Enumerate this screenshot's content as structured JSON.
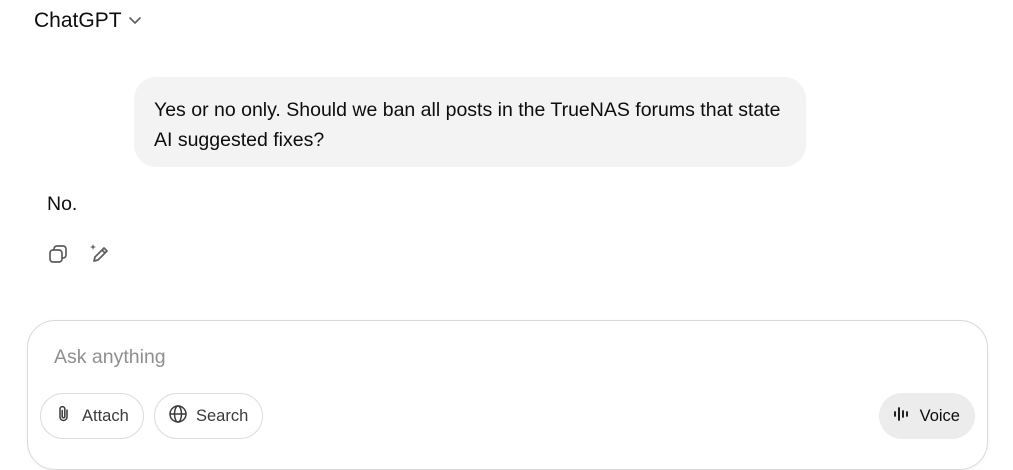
{
  "header": {
    "title": "ChatGPT",
    "menu_icon": "chevron-down-icon"
  },
  "conversation": {
    "user_message": "Yes or no only. Should we ban all posts in the TrueNAS forums that state AI suggested fixes?",
    "assistant_message": "No.",
    "actions": [
      {
        "icon": "copy-icon"
      },
      {
        "icon": "edit-in-canvas-icon"
      }
    ]
  },
  "composer": {
    "placeholder": "Ask anything",
    "value": "",
    "attach_label": "Attach",
    "search_label": "Search",
    "voice_label": "Voice"
  }
}
